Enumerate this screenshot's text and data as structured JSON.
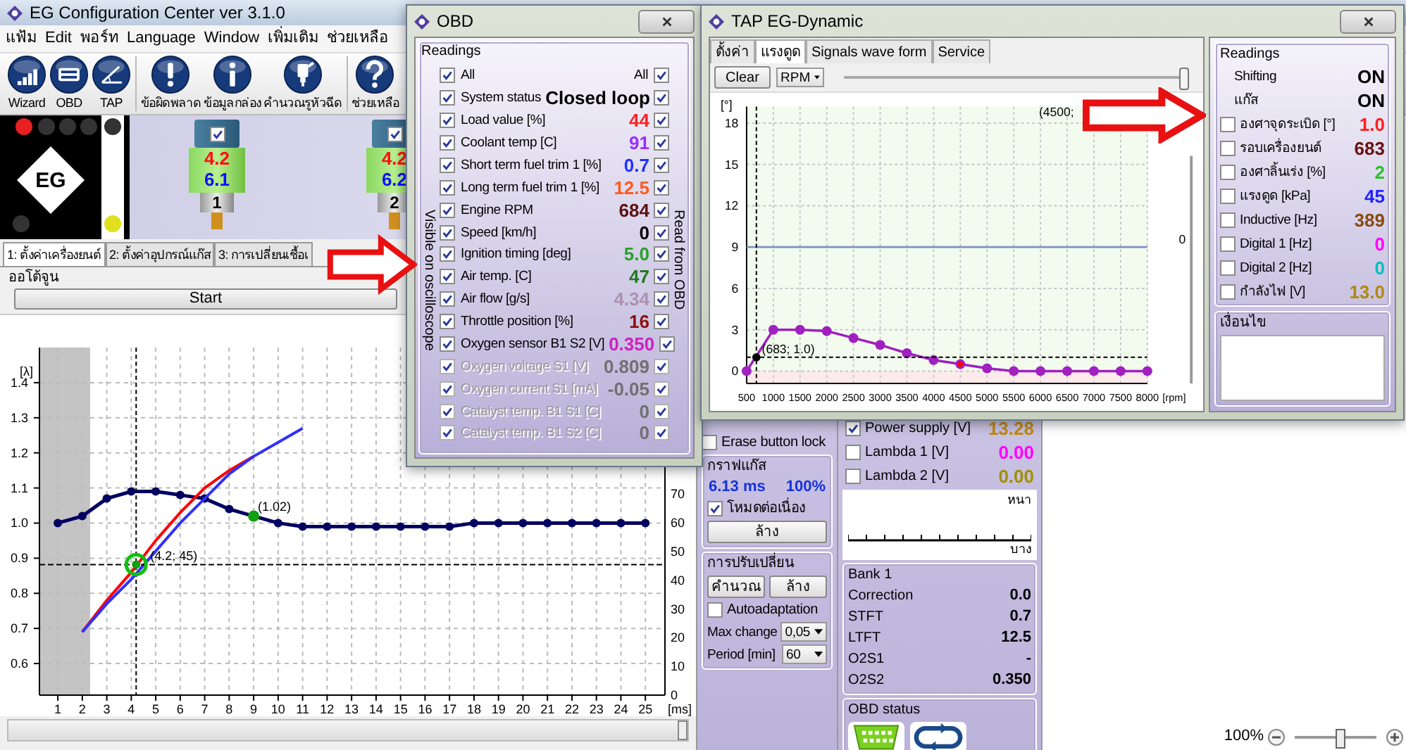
{
  "main_window": {
    "title": "EG Configuration Center ver 3.1.0",
    "menu": [
      "แฟ้ม",
      "Edit",
      "พอร์ท",
      "Language",
      "Window",
      "เพิ่มเติม",
      "ช่วยเหลือ"
    ],
    "toolbar": [
      {
        "label": "Wizard",
        "kind": "wizard"
      },
      {
        "label": "OBD",
        "kind": "obd"
      },
      {
        "label": "TAP",
        "kind": "tap"
      },
      {
        "label": "ข้อผิดพลาด",
        "kind": "error"
      },
      {
        "label": "ข้อมูลกล่อง",
        "kind": "info"
      },
      {
        "label": "คำนวณรูหัวฉีด",
        "kind": "injector"
      },
      {
        "label": "ช่วยเหลือ",
        "kind": "help"
      }
    ],
    "logo_text": "EG",
    "leds": [
      {
        "on": true
      },
      {
        "on": false
      },
      {
        "on": false
      },
      {
        "on": false
      },
      {
        "on": false
      },
      {
        "on": false
      },
      {
        "on": true
      }
    ],
    "injectors": [
      {
        "checked": true,
        "value_1": "4.2",
        "value_2": "6.1",
        "number": "1"
      },
      {
        "checked": true,
        "value_1": "4.2",
        "value_2": "6.2",
        "number": "2"
      }
    ],
    "tabs": [
      {
        "label": "1: ตั้งค่าเครื่องยนต์",
        "selected": true
      },
      {
        "label": "2: ตั้งค่าอุปกรณ์แก๊ส",
        "selected": false
      },
      {
        "label": "3: การเปลี่ยนเชื้อเ",
        "selected": false
      }
    ],
    "autotune": {
      "title": "ออโต้จูน",
      "start_button": "Start"
    },
    "chart": {
      "right_ticks": [
        "70",
        "60",
        "50",
        "40",
        "30",
        "20",
        "10",
        "0"
      ],
      "chart_data": {
        "type": "line",
        "xlabel": "[ms]",
        "ylabel": "[λ]",
        "x": [
          1,
          2,
          3,
          4,
          5,
          6,
          7,
          8,
          9,
          10,
          11,
          12,
          13,
          14,
          15,
          16,
          17,
          18,
          19,
          20,
          21,
          22,
          23,
          24,
          25
        ],
        "series": [
          {
            "color": "#000060",
            "marker": "o",
            "values": [
              1.0,
              1.02,
              1.07,
              1.09,
              1.09,
              1.08,
              1.07,
              1.04,
              1.02,
              1.0,
              0.99,
              0.99,
              0.99,
              0.99,
              0.99,
              0.99,
              0.99,
              1.0,
              1.0,
              1.0,
              1.0,
              1.0,
              1.0,
              1.0,
              1.0
            ]
          },
          {
            "color": "#ff0000",
            "values": [
              null,
              0.69,
              0.78,
              0.86,
              0.95,
              1.03,
              1.1,
              1.15,
              1.19,
              null,
              null,
              null,
              null,
              null,
              null,
              null,
              null,
              null,
              null,
              null,
              null,
              null,
              null,
              null,
              null
            ]
          },
          {
            "color": "#3030ff",
            "values": [
              null,
              0.69,
              0.77,
              0.84,
              0.92,
              1.0,
              1.07,
              1.14,
              1.19,
              1.23,
              1.27,
              null,
              null,
              null,
              null,
              null,
              null,
              null,
              null,
              null,
              null,
              null,
              null,
              null,
              null
            ]
          }
        ],
        "xlim": [
          0.25,
          25.8
        ],
        "ylim": [
          0.51,
          1.5
        ],
        "xticks": [
          1,
          2,
          3,
          4,
          5,
          6,
          7,
          8,
          9,
          10,
          11,
          12,
          13,
          14,
          15,
          16,
          17,
          18,
          19,
          20,
          21,
          22,
          23,
          24,
          25
        ],
        "yticks": [
          {
            "value": 0.6,
            "label": "0.6"
          },
          {
            "value": 0.7,
            "label": "0.7"
          },
          {
            "value": 0.8,
            "label": "0.8"
          },
          {
            "value": 0.9,
            "label": "0.9"
          },
          {
            "value": 1.0,
            "label": "1.0"
          },
          {
            "value": 1.1,
            "label": "1.1"
          },
          {
            "value": 1.2,
            "label": "1.2"
          },
          {
            "value": 1.3,
            "label": "1.3"
          },
          {
            "value": 1.4,
            "label": "1.4"
          }
        ],
        "grid": true,
        "ref_lines": [
          {
            "axis": "x",
            "value": 4.2
          },
          {
            "axis": "y",
            "value": 0.882
          }
        ],
        "bands": [
          {
            "axis": "x",
            "from": 0.25,
            "to": 2.32
          }
        ],
        "annotations": [
          {
            "x": 4.2,
            "y": 0.882,
            "text": "(4.2; 45)"
          },
          {
            "x": 9,
            "y": 1.02,
            "text": "(1.02)"
          }
        ]
      }
    },
    "erase_lock": {
      "label": "Erase button lock",
      "checked": false
    },
    "gas_graph": {
      "title": "กราฟแก๊ส",
      "time": "6.13 ms",
      "percent": "100%",
      "continuous": {
        "label": "โหมดต่อเนื่อง",
        "checked": true
      },
      "clear_button": "ล้าง"
    },
    "adaptation": {
      "title": "การปรับเปลี่ยน",
      "calc_button": "คำนวณ",
      "clear_button": "ล้าง",
      "auto": {
        "label": "Autoadaptation",
        "checked": false
      },
      "max_change": {
        "label": "Max change",
        "value": "0,05"
      },
      "period": {
        "label": "Period [min]",
        "value": "60"
      }
    },
    "signals": [
      {
        "label": "Power supply [V]",
        "checked": true,
        "value": "13.28",
        "color": "#c08a10"
      },
      {
        "label": "Lambda 1 [V]",
        "checked": false,
        "value": "0.00",
        "color": "#ff00ff"
      },
      {
        "label": "Lambda 2 [V]",
        "checked": false,
        "value": "0.00",
        "color": "#a09000"
      }
    ],
    "lambda_scope": {
      "rich_label": "หนา",
      "lean_label": "บาง"
    },
    "bank": {
      "title": "Bank 1",
      "rows": [
        {
          "label": "Correction",
          "value": "0.0"
        },
        {
          "label": "STFT",
          "value": "0.7"
        },
        {
          "label": "LTFT",
          "value": "12.5"
        },
        {
          "label": "O2S1",
          "value": "-"
        },
        {
          "label": "O2S2",
          "value": "0.350"
        }
      ]
    },
    "obd_status": {
      "title": "OBD status"
    },
    "zoom": {
      "value": "100%",
      "level": 0.55
    }
  },
  "obd_window": {
    "title": "OBD",
    "group": "Readings",
    "all_left": {
      "label": "All",
      "checked": true
    },
    "all_right": {
      "label": "All",
      "checked": true
    },
    "left_caption": "Visible on oscilloscope",
    "right_caption": "Read from OBD",
    "rows": [
      {
        "label": "System status",
        "value": "Closed loop",
        "color": "#000000",
        "disabled": false,
        "visible": true,
        "read": true
      },
      {
        "label": "Load value [%]",
        "value": "44",
        "color": "#ff2020",
        "disabled": false,
        "visible": true,
        "read": true
      },
      {
        "label": "Coolant temp [C]",
        "value": "91",
        "color": "#9b30ff",
        "disabled": false,
        "visible": true,
        "read": true
      },
      {
        "label": "Short term fuel trim 1 [%]",
        "value": "0.7",
        "color": "#2030ff",
        "disabled": false,
        "visible": true,
        "read": true
      },
      {
        "label": "Long term fuel trim 1 [%]",
        "value": "12.5",
        "color": "#ff5a1e",
        "disabled": false,
        "visible": true,
        "read": true
      },
      {
        "label": "Engine RPM",
        "value": "684",
        "color": "#5a1010",
        "disabled": false,
        "visible": true,
        "read": true
      },
      {
        "label": "Speed [km/h]",
        "value": "0",
        "color": "#000000",
        "disabled": false,
        "visible": true,
        "read": true
      },
      {
        "label": "Ignition timing [deg]",
        "value": "5.0",
        "color": "#2aa02a",
        "disabled": false,
        "visible": true,
        "read": true
      },
      {
        "label": "Air temp. [C]",
        "value": "47",
        "color": "#207a20",
        "disabled": false,
        "visible": true,
        "read": true
      },
      {
        "label": "Air flow [g/s]",
        "value": "4.34",
        "color": "#b090b0",
        "disabled": false,
        "visible": true,
        "read": true
      },
      {
        "label": "Throttle position [%]",
        "value": "16",
        "color": "#8b1010",
        "disabled": false,
        "visible": true,
        "read": true
      },
      {
        "label": "Oxygen sensor B1 S2 [V]",
        "value": "0.350",
        "color": "#d020c0",
        "disabled": false,
        "visible": true,
        "read": true
      },
      {
        "label": "Oxygen voltage S1 [V]",
        "value": "0.809",
        "color": "#707070",
        "disabled": true,
        "visible": true,
        "read": true
      },
      {
        "label": "Oxygen current S1 [mA]",
        "value": "-0.05",
        "color": "#707070",
        "disabled": true,
        "visible": true,
        "read": true
      },
      {
        "label": "Catalyst temp. B1 S1 [C]",
        "value": "0",
        "color": "#707070",
        "disabled": true,
        "visible": true,
        "read": true
      },
      {
        "label": "Catalyst temp. B1 S2 [C]",
        "value": "0",
        "color": "#707070",
        "disabled": true,
        "visible": true,
        "read": true
      }
    ]
  },
  "tap_window": {
    "title": "TAP EG-Dynamic",
    "tabs": [
      {
        "label": "ตั้งค่า",
        "selected": false
      },
      {
        "label": "แรงดูด",
        "selected": true
      },
      {
        "label": "Signals wave form",
        "selected": false
      },
      {
        "label": "Service",
        "selected": false
      }
    ],
    "clear_button": "Clear",
    "mode_select": "RPM",
    "range_slider": {
      "level": 1
    },
    "side_value": "0",
    "chart": {
      "chart_data": {
        "type": "line",
        "ylabel": "[°]",
        "xlabel": "[rpm]",
        "x": [
          500,
          1000,
          1500,
          2000,
          2500,
          3000,
          3500,
          4000,
          4500,
          5000,
          5500,
          6000,
          6500,
          7000,
          7500,
          8000
        ],
        "series": [
          {
            "color": "#a020c0",
            "marker": "o",
            "values": [
              0,
              3,
              3,
              2.9,
              2.4,
              1.9,
              1.3,
              0.8,
              0.5,
              0.2,
              0,
              0,
              0,
              0,
              0,
              0
            ]
          },
          {
            "color": "#8090c0",
            "values": [
              9,
              9,
              9,
              9,
              9,
              9,
              9,
              9,
              9,
              9,
              9,
              9,
              9,
              9,
              9,
              9
            ]
          },
          {
            "color": "#ff0000",
            "marker": "o",
            "values": [
              null,
              null,
              null,
              null,
              null,
              null,
              null,
              null,
              0.5,
              null,
              null,
              null,
              null,
              null,
              null,
              null
            ]
          }
        ],
        "xlim": [
          500,
          8000
        ],
        "ylim": [
          -0.9,
          19.2
        ],
        "xticks": [
          500,
          1000,
          1500,
          2000,
          2500,
          3000,
          3500,
          4000,
          4500,
          5000,
          5500,
          6000,
          6500,
          7000,
          7500,
          8000
        ],
        "yticks": [
          0,
          3,
          6,
          9,
          12,
          15,
          18
        ],
        "grid": true,
        "ref_lines": [
          {
            "axis": "x",
            "value": 683
          },
          {
            "axis": "y",
            "value": 1.0
          }
        ],
        "annotations": [
          {
            "x": 683,
            "y": 1.0,
            "text": "(683; 1.0)"
          },
          "(4500;"
        ]
      }
    },
    "readings_title": "Readings",
    "status": [
      {
        "label": "Shifting",
        "value": "ON"
      },
      {
        "label": "แก๊ส",
        "value": "ON"
      }
    ],
    "readings": [
      {
        "label": "องศาจุดระเบิด [°]",
        "checked": false,
        "value": "1.0",
        "color": "#ff2020"
      },
      {
        "label": "รอบเครื่องยนต์",
        "checked": false,
        "value": "683",
        "color": "#6a1010"
      },
      {
        "label": "องศาลิ้นเร่ง [%]",
        "checked": false,
        "value": "2",
        "color": "#30c030"
      },
      {
        "label": "แรงดูด [kPa]",
        "checked": false,
        "value": "45",
        "color": "#2020ff"
      },
      {
        "label": "Inductive [Hz]",
        "checked": false,
        "value": "389",
        "color": "#8a4a10"
      },
      {
        "label": "Digital 1 [Hz]",
        "checked": false,
        "value": "0",
        "color": "#ff00ff"
      },
      {
        "label": "Digital 2 [Hz]",
        "checked": false,
        "value": "0",
        "color": "#00c0c0"
      },
      {
        "label": "กำลังไฟ [V]",
        "checked": false,
        "value": "13.0",
        "color": "#b08a10"
      }
    ],
    "condition": {
      "title": "เงื่อนไข"
    }
  }
}
